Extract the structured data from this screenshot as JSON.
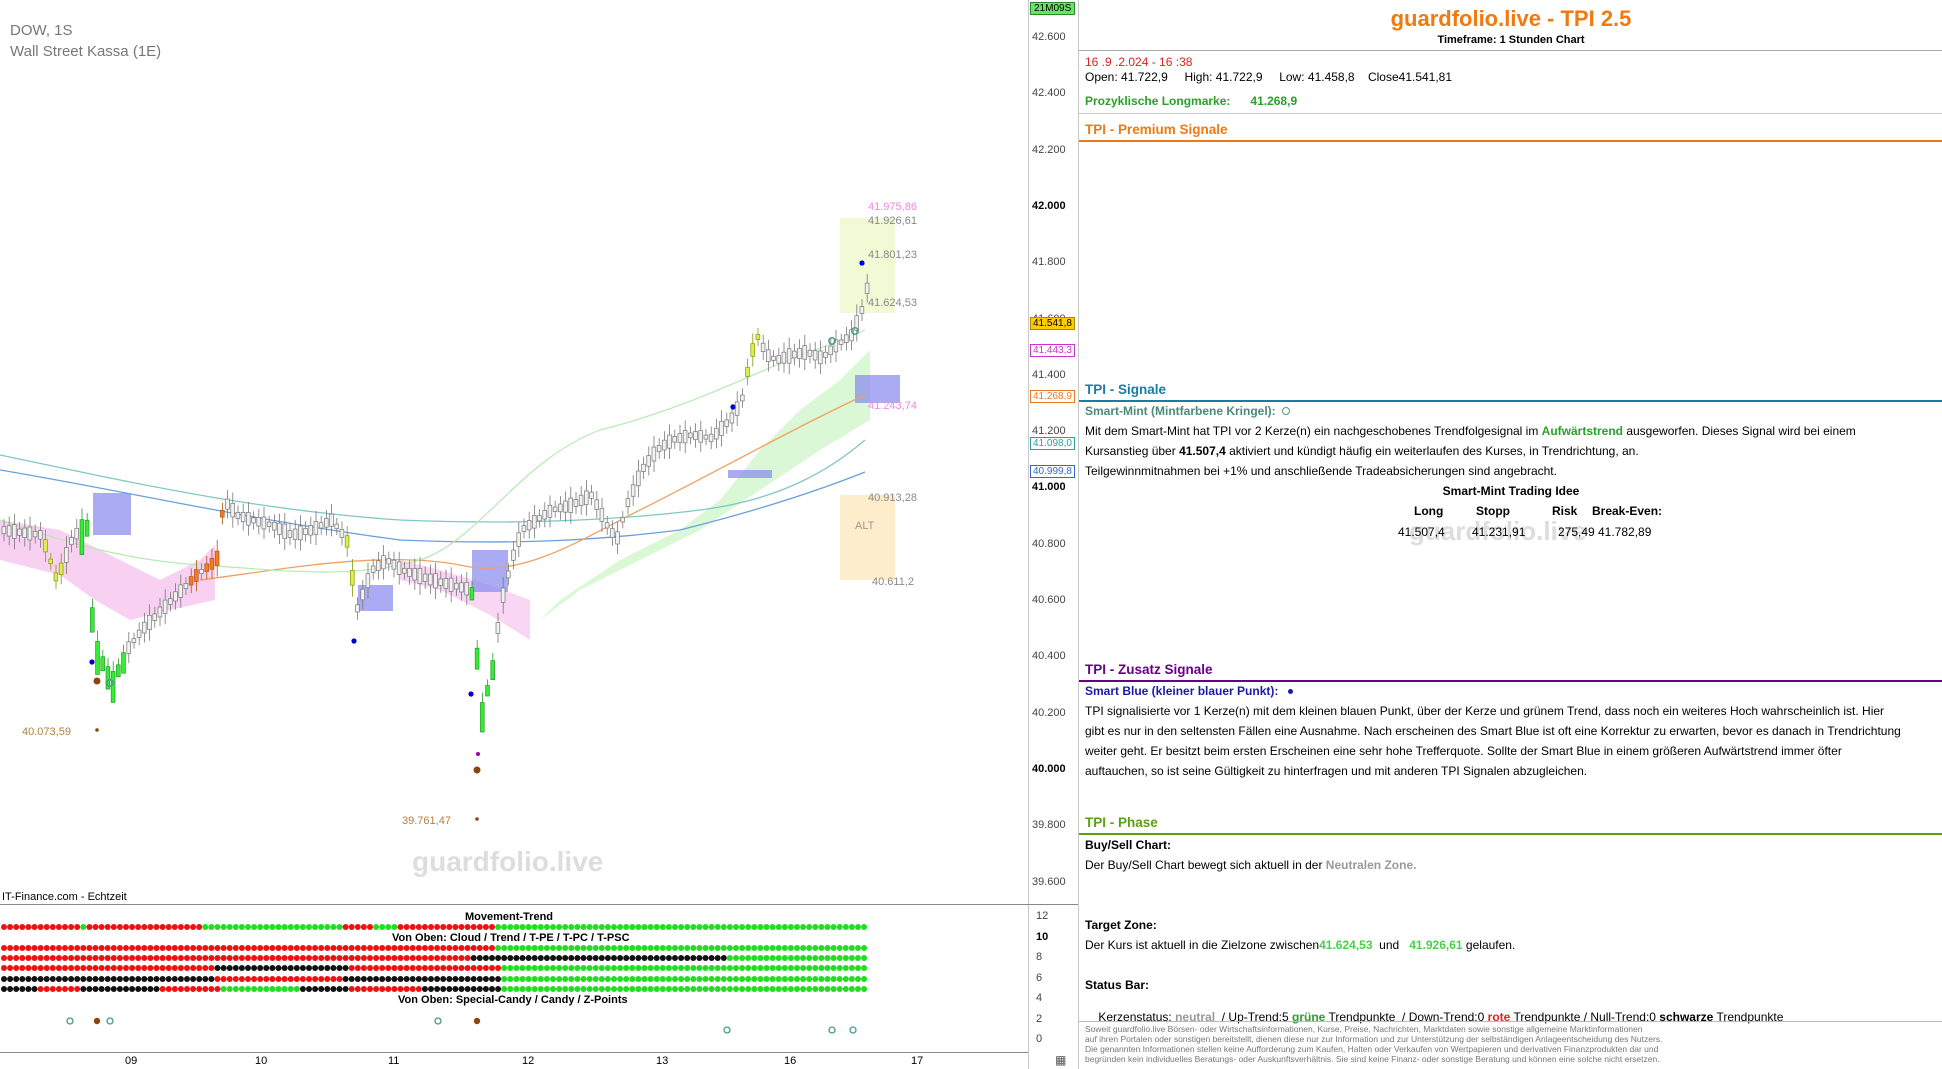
{
  "chart": {
    "symbol": "DOW, 1S",
    "instrument": "Wall Street Kassa (1E)",
    "source": "IT-Finance.com - Echtzeit",
    "watermark": "guardfolio.live",
    "countdown": "21M09S",
    "price_axis": [
      "42.600",
      "42.400",
      "42.200",
      "42.000",
      "41.800",
      "41.600",
      "41.400",
      "41.200",
      "41.000",
      "40.800",
      "40.600",
      "40.400",
      "40.200",
      "40.000",
      "39.800",
      "39.600"
    ],
    "price_tags": {
      "current": "41.541,8",
      "magenta": "41.443,3",
      "orange": "41.268,9",
      "teal": "41.098,0",
      "blue": "40.999,8"
    },
    "level_labels": {
      "l1": "41.975,86",
      "l2": "41.926,61",
      "l3": "41.801,23",
      "l4": "41.624,53",
      "l5": "41.243,74",
      "l6": "40.913,28",
      "l7": "40.611,2",
      "l8": "40.073,59",
      "l9": "39.761,47",
      "alt": "ALT"
    },
    "date_axis": [
      "09",
      "10",
      "11",
      "12",
      "13",
      "16",
      "17"
    ],
    "sub_axis": [
      "12",
      "10",
      "8",
      "6",
      "4",
      "2",
      "0"
    ],
    "sub_titles": {
      "movement": "Movement-Trend",
      "cloud": "Von Oben: Cloud / Trend / T-PE / T-PC / T-PSC",
      "candy": "Von Oben: Special-Candy / Candy / Z-Points"
    },
    "colors": {
      "green": "#22dd22",
      "red": "#ee1111",
      "black": "#111111",
      "bull": "#33ee33",
      "bear": "#ff7722",
      "neutral": "#f2f2f2"
    }
  },
  "panel": {
    "title": "guardfolio.live - TPI 2.5",
    "timeframe": "Timeframe: 1 Stunden Chart",
    "datetime": "16 .9 .2.024  - 16 :38",
    "ohlc": {
      "open_label": "Open:",
      "open": "41.722,9",
      "high_label": "High:",
      "high": "41.722,9",
      "low_label": "Low:",
      "low": "41.458,8",
      "close_label": "Close",
      "close": "41.541,81"
    },
    "longmarke_label": "Prozyklische Longmarke:",
    "longmarke": "41.268,9",
    "premium": {
      "title": "TPI - Premium Signale"
    },
    "signals": {
      "title": "TPI - Signale",
      "subtitle": "Smart-Mint (Mintfarbene Kringel):",
      "p1a": "Mit dem Smart-Mint hat TPI vor 2  Kerze(n) ein nachgeschobenes Trendfolgesignal im ",
      "p1b": "Aufwärtstrend",
      "p1c": " ausgeworfen. Dieses Signal wird bei einem",
      "p2a": "Kursanstieg über ",
      "p2b": "41.507,4",
      "p2c": "   aktiviert und kündigt häufig ein weiterlaufen des Kurses, in Trendrichtung, an.",
      "p3": "Teilgewinnmitnahmen bei +1% und anschließende Tradeabsicherungen sind angebracht.",
      "idea_title": "Smart-Mint Trading Idee",
      "idea_headers": [
        "Long",
        "Stopp",
        "Risk",
        "Break-Even:"
      ],
      "idea_values": [
        "41.507,4",
        "41.231,91",
        "275,49",
        "41.782,89"
      ],
      "watermark": "guardfolio.live"
    },
    "zusatz": {
      "title": "TPI - Zusatz Signale",
      "subtitle": "Smart Blue (kleiner blauer Punkt):",
      "lines": [
        "TPI signalisierte vor 1  Kerze(n) mit dem kleinen blauen Punkt, über der Kerze und grünem Trend, dass noch ein weiteres Hoch wahrscheinlich ist. Hier",
        "gibt es nur in den seltensten Fällen eine Ausnahme. Nach erscheinen des Smart Blue ist oft eine Korrektur zu erwarten, bevor es danach in Trendrichtung",
        "weiter geht. Er besitzt beim ersten Erscheinen eine sehr hohe Trefferquote. Sollte der Smart Blue in einem größeren Aufwärtstrend immer öfter",
        "auftauchen, so ist seine Gültigkeit zu hinterfragen und mit anderen TPI Signalen abzugleichen."
      ]
    },
    "phase": {
      "title": "TPI - Phase",
      "buysell_title": "Buy/Sell Chart:",
      "buysell_a": "Der Buy/Sell Chart bewegt sich aktuell in der ",
      "buysell_b": "Neutralen Zone.",
      "target_title": "Target Zone:",
      "target_a": "Der Kurs ist aktuell in die Zielzone zwischen",
      "target_b": "41.624,53",
      "target_c": "  und   ",
      "target_d": "41.926,61",
      "target_e": "  gelaufen.",
      "status_title": "Status Bar:",
      "status": {
        "a": "Kerzenstatus: ",
        "b": "neutral",
        "c": "  / Up-Trend:5 ",
        "d": "grüne",
        "e": " Trendpunkte  / Down-Trend:0 ",
        "f": "rote",
        "g": " Trendpunkte / Null-Trend:0 ",
        "h": "schwarze",
        "i": " Trendpunkte"
      }
    },
    "disclaimer": [
      "Soweit guardfolio.live Börsen- oder Wirtschaftsinformationen, Kurse, Preise, Nachrichten, Marktdaten sowie sonstige allgemeine Marktinformationen",
      "auf ihren Portalen oder sonstigen bereitstellt, dienen diese nur zur Information und zur Unterstützung der selbständigen Anlageentscheidung des Nutzers.",
      "Die genannten Informationen stellen keine Aufforderung zum Kaufen, Halten oder Verkaufen von Wertpapieren und derivativen Finanzprodukten dar und",
      "begründen kein individuelles Beratungs- oder Auskunftsverhältnis. Sie sind keine Finanz- oder sonstige Beratung und können eine solche nicht ersetzen."
    ]
  }
}
